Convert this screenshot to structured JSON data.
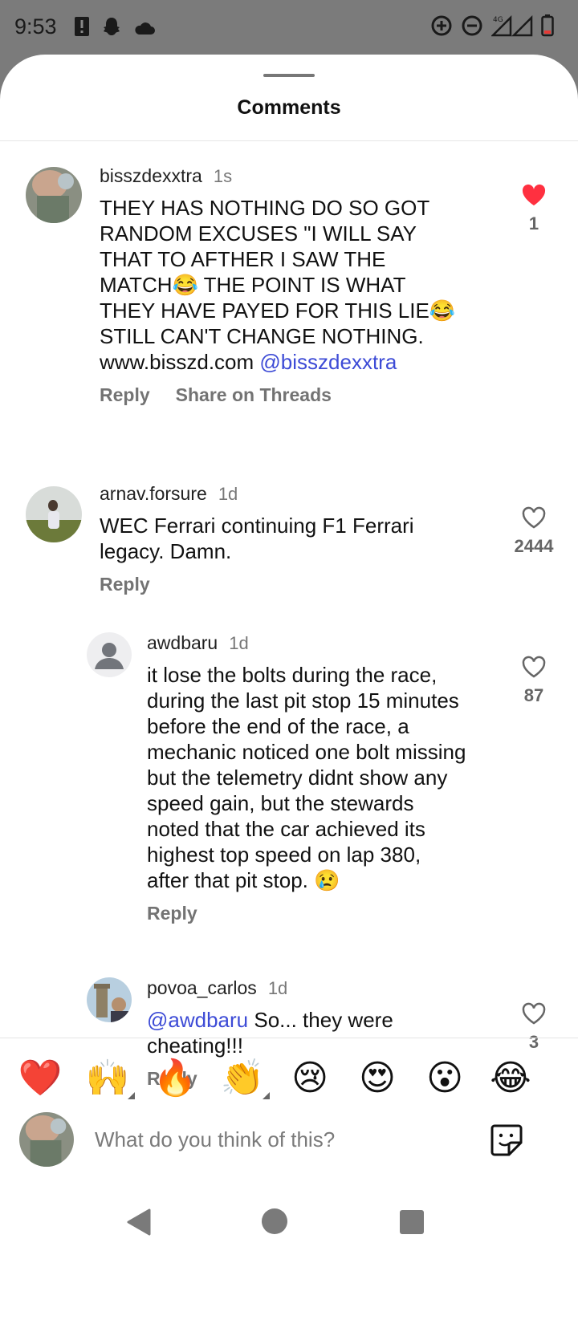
{
  "status_bar": {
    "time": "9:53",
    "network": "4G",
    "icons_left": [
      "alert-icon",
      "snapchat-ghost-icon",
      "cloud-icon"
    ],
    "icons_right": [
      "data-saver-icon",
      "do-not-disturb-icon",
      "signal-icon",
      "battery-low-icon"
    ]
  },
  "sheet": {
    "title": "Comments"
  },
  "comments": [
    {
      "user": "bisszdexxtra",
      "time": "1s",
      "text_main": "THEY HAS NOTHING DO SO GOT RANDOM EXCUSES \"I WILL SAY THAT TO AFTHER I SAW THE MATCH😂 THE POINT IS WHAT THEY HAVE PAYED FOR THIS LIE😂 STILL CAN'T CHANGE NOTHING. www.bisszd.com ",
      "mention": "@bisszdexxtra",
      "reply_label": "Reply",
      "share_label": "Share on Threads",
      "likes": "1",
      "liked": true
    },
    {
      "user": "arnav.forsure",
      "time": "1d",
      "text": "WEC Ferrari continuing F1 Ferrari legacy. Damn.",
      "reply_label": "Reply",
      "likes": "2444",
      "liked": false
    },
    {
      "user": "awdbaru",
      "time": "1d",
      "text": "it lose the bolts during the race, during the last pit stop 15 minutes before the end of the race, a mechanic noticed one bolt missing but the telemetry didnt show any speed gain, but the stewards noted that the car achieved its highest top speed on lap 380, after that pit stop. 😢",
      "reply_label": "Reply",
      "likes": "87",
      "liked": false
    },
    {
      "user": "povoa_carlos",
      "time": "1d",
      "mention": "@awdbaru",
      "text_after": " So... they were cheating!!!",
      "reply_label": "Reply",
      "likes": "3",
      "liked": false
    }
  ],
  "emoji_bar": [
    "❤️",
    "🙌",
    "🔥",
    "👏",
    "😢",
    "😍",
    "😮",
    "😂"
  ],
  "composer": {
    "placeholder": "What do you think of this?"
  },
  "colors": {
    "like_red": "#ff3040",
    "mention_blue": "#3d4bd6",
    "muted_text": "#737373"
  }
}
